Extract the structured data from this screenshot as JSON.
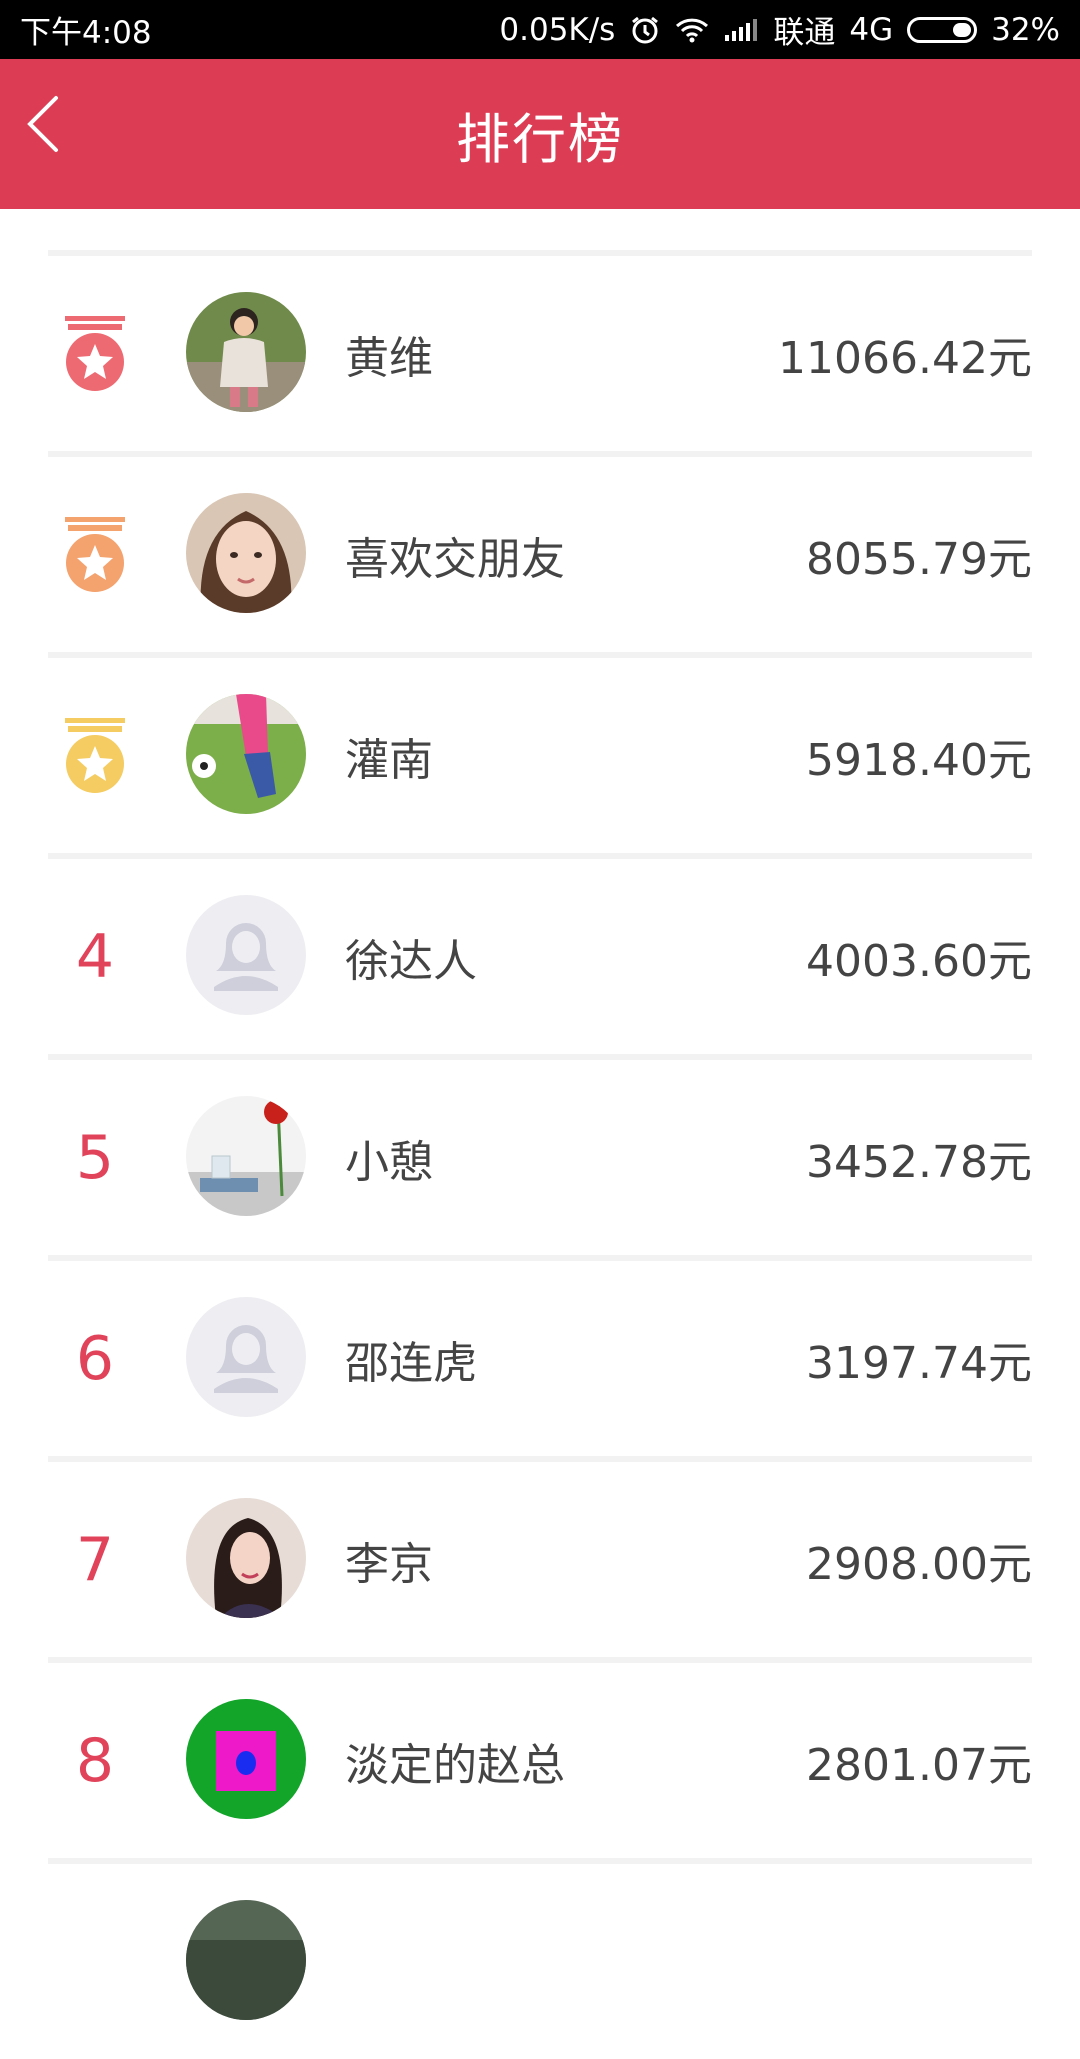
{
  "status_bar": {
    "time": "下午4:08",
    "speed": "0.05K/s",
    "carrier": "联通",
    "network": "4G",
    "battery": "32%"
  },
  "header": {
    "title": "排行榜",
    "back_icon": "chevron-left-icon"
  },
  "colors": {
    "header_bg": "#dc3d54",
    "rank_text": "#e0435a",
    "medal_gold": "#f4cc62",
    "medal_silver": "#f4a26e",
    "medal_first": "#ee6a72"
  },
  "leaderboard": [
    {
      "rank": "1",
      "name": "黄维",
      "amount": "11066.42元",
      "avatar": "photo-avatar"
    },
    {
      "rank": "2",
      "name": "喜欢交朋友",
      "amount": "8055.79元",
      "avatar": "photo-avatar"
    },
    {
      "rank": "3",
      "name": "灌南",
      "amount": "5918.40元",
      "avatar": "photo-avatar"
    },
    {
      "rank": "4",
      "name": "徐达人",
      "amount": "4003.60元",
      "avatar": "default-avatar"
    },
    {
      "rank": "5",
      "name": "小憩",
      "amount": "3452.78元",
      "avatar": "photo-avatar"
    },
    {
      "rank": "6",
      "name": "邵连虎",
      "amount": "3197.74元",
      "avatar": "default-avatar"
    },
    {
      "rank": "7",
      "name": "李京",
      "amount": "2908.00元",
      "avatar": "photo-avatar"
    },
    {
      "rank": "8",
      "name": "淡定的赵总",
      "amount": "2801.07元",
      "avatar": "pattern-avatar"
    }
  ]
}
